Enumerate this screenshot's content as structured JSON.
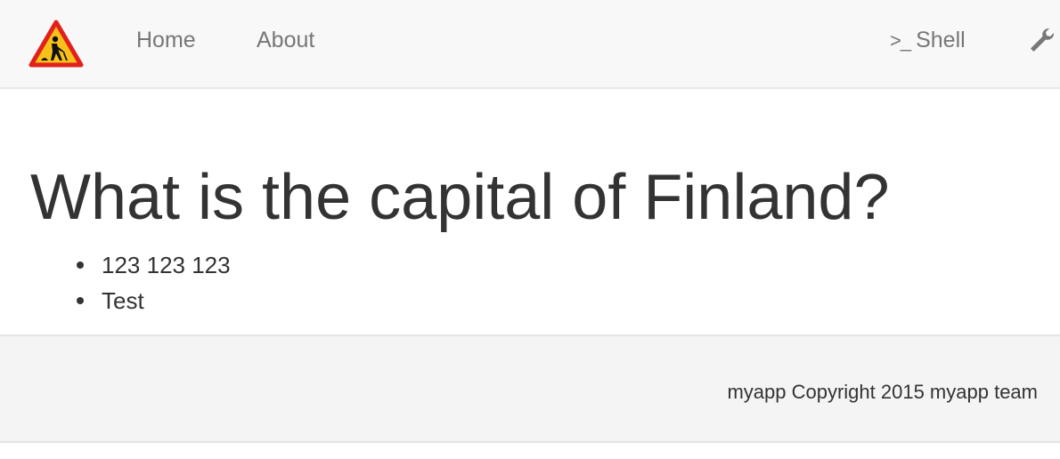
{
  "navbar": {
    "logo_icon": "construction-warning-sign-icon",
    "links": {
      "home": "Home",
      "about": "About",
      "shell": "Shell",
      "shell_icon": ">_",
      "tools_icon": "wrench-icon"
    },
    "colors": {
      "background": "#f8f8f8",
      "link": "#777777"
    }
  },
  "main": {
    "question": "What is the capital of Finland?",
    "answers": [
      "123 123 123",
      "Test"
    ]
  },
  "footer": {
    "text": "myapp Copyright 2015 myapp team",
    "background": "#f4f4f4"
  }
}
